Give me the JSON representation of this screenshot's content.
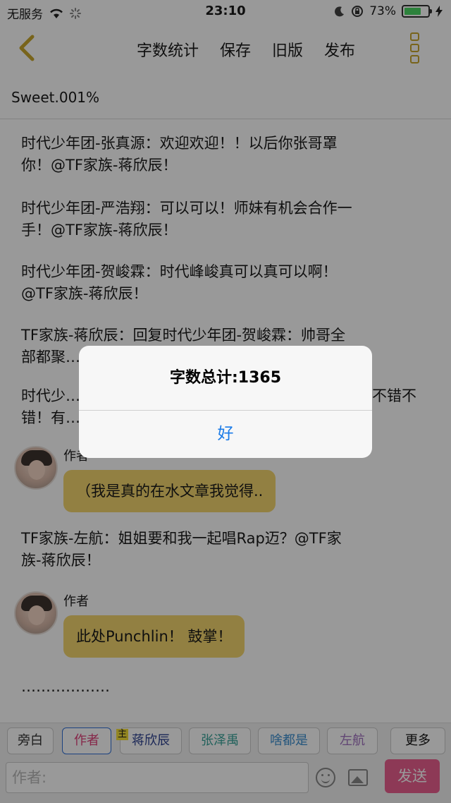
{
  "status_bar": {
    "carrier": "无服务",
    "time": "23:10",
    "battery_percent": "73%",
    "battery_level": 0.73
  },
  "nav": {
    "actions": [
      "字数统计",
      "保存",
      "旧版",
      "发布"
    ]
  },
  "document": {
    "title": "Sweet.001%",
    "paragraphs": [
      [
        "时代少年团-张真源：欢迎欢迎！！以后你张哥罩",
        "你！@TF家族-蒋欣辰！"
      ],
      [
        "时代少年团-严浩翔：可以可以！师妹有机会合作一",
        "手！@TF家族-蒋欣辰！"
      ],
      [
        "时代少年团-贺峻霖：时代峰峻真可以真可以啊！",
        "@TF家族-蒋欣辰！"
      ],
      [
        "TF家族-蒋欣辰：回复时代少年团-贺峻霖：帅哥全",
        "部都聚…"
      ],
      [
        "时代少…",
        "错！有…"
      ]
    ],
    "paragraph5_tail": "不错不",
    "author_blocks": [
      {
        "label": "作者",
        "bubble_text": "（我是真的在水文章我觉得.."
      },
      {
        "label": "作者",
        "bubble_text": "此处Punchlin！ 鼓掌！"
      }
    ],
    "paragraph_after_first_bubble": [
      "TF家族-左航：姐姐要和我一起唱Rap迈？@TF家",
      "族-蒋欣辰！"
    ],
    "ellipsis": "………………"
  },
  "toolbar": {
    "chips": [
      "旁白",
      "作者",
      "蒋欣辰",
      "张泽禹",
      "啥都是",
      "左航",
      "更多"
    ],
    "chip_text_colors": [
      "#333333",
      "#e0407a",
      "#2a3f8f",
      "#3aa39a",
      "#3d8fd0",
      "#a070c0",
      "#111111"
    ],
    "main_badge": "主"
  },
  "input": {
    "placeholder": "作者:",
    "send_label": "发送"
  },
  "alert": {
    "title": "字数总计:1365",
    "button_label": "好"
  },
  "colors": {
    "accent_gold": "#c9a72e",
    "bubble_yellow": "#f3d56e",
    "send_pink": "#ec5f8f",
    "alert_blue": "#1a7be8"
  }
}
